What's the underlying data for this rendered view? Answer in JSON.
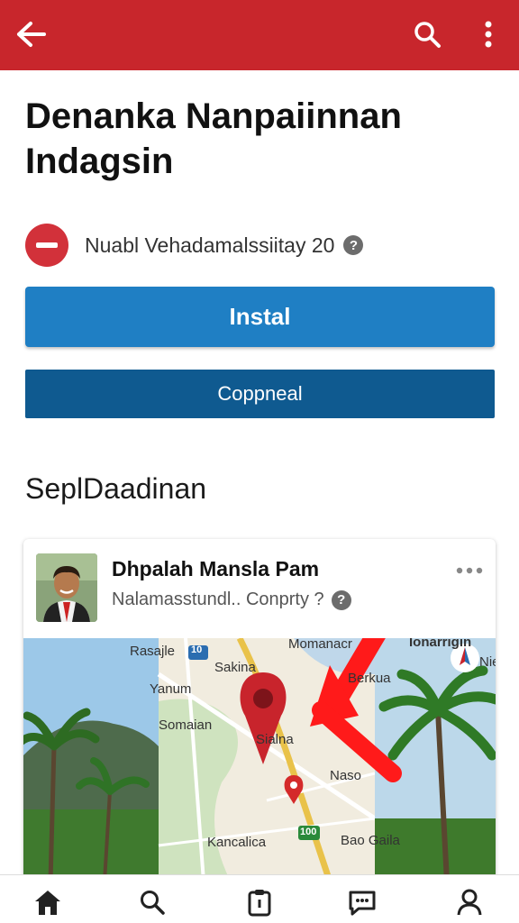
{
  "header": {
    "back_icon": "arrow-left-icon",
    "search_icon": "search-icon",
    "more_icon": "more-vertical-icon",
    "bar_color": "#c8262c"
  },
  "app": {
    "title": "Denanka Nanpaiinnan Indagsin",
    "status_icon": "minus-circle-icon",
    "status_text": "Nuabl Vehadamalssiitay 20",
    "status_help_icon": "help-icon"
  },
  "actions": {
    "install_label": "Instal",
    "secondary_label": "Coppneal",
    "install_color": "#1f7fc4",
    "secondary_color": "#0f5a90"
  },
  "section": {
    "title": "SeplDaadinan"
  },
  "post": {
    "author": "Dhpalah Mansla Pam",
    "subtitle": "Nalamasstundl.. Conprty ?",
    "more_icon": "more-horizontal-icon",
    "map_labels": {
      "l1": "Rasajle",
      "l2": "Sakina",
      "l3": "Momanacr",
      "l4": "Ionarrigin",
      "l5": "Berkua",
      "l6": "Nie",
      "l7": "Yanum",
      "l8": "Somaian",
      "l9": "Sialna",
      "l10": "Naso",
      "l11": "Kancalica",
      "l12": "Bao Gaila",
      "badge1": "10",
      "badge2": "100"
    },
    "map_pin_icon": "map-pin-icon",
    "arrow_annotation": "red-arrow-annotation",
    "navigate_icon": "navigate-icon"
  },
  "bottom_nav": {
    "items": [
      {
        "icon": "home-icon"
      },
      {
        "icon": "search-icon"
      },
      {
        "icon": "clipboard-icon"
      },
      {
        "icon": "chat-icon"
      },
      {
        "icon": "profile-icon"
      }
    ]
  }
}
